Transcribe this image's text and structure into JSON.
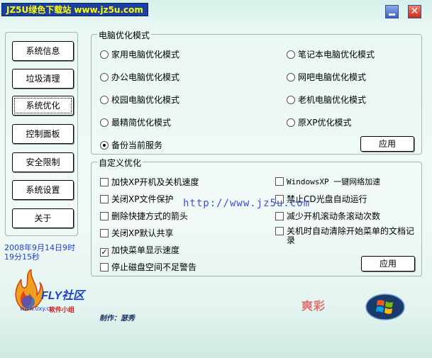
{
  "titlebar": {
    "brand": "JZ5U绿色下载站 www.jz5u.com",
    "close_glyph": "✕"
  },
  "sidebar": {
    "items": [
      {
        "label": "系统信息"
      },
      {
        "label": "垃圾清理"
      },
      {
        "label": "系统优化"
      },
      {
        "label": "控制面板"
      },
      {
        "label": "安全限制"
      },
      {
        "label": "系统设置"
      },
      {
        "label": "关于"
      }
    ],
    "active": "系统优化"
  },
  "datetime": {
    "line1": "2008年9月14日9时",
    "line2": "19分15秒"
  },
  "logo": {
    "name": "FLY社区",
    "url": "www.0xy.cn",
    "subtitle": "软件小组"
  },
  "author": "制作：瑟秀",
  "stamp": "爽彩",
  "mode_group": {
    "legend": "电脑优化模式",
    "options": [
      {
        "label": "家用电脑优化模式",
        "selected": false
      },
      {
        "label": "笔记本电脑优化模式",
        "selected": false
      },
      {
        "label": "办公电脑优化模式",
        "selected": false
      },
      {
        "label": "网吧电脑优化模式",
        "selected": false
      },
      {
        "label": "校园电脑优化模式",
        "selected": false
      },
      {
        "label": "老机电脑优化模式",
        "selected": false
      },
      {
        "label": "最精简优化模式",
        "selected": false
      },
      {
        "label": "原XP优化模式",
        "selected": false
      },
      {
        "label": "备份当前服务",
        "selected": true
      }
    ],
    "apply_label": "应用"
  },
  "custom_group": {
    "legend": "自定义优化",
    "options": [
      {
        "label": "加快XP开机及关机速度",
        "checked": false
      },
      {
        "label": "WindowsXP 一键网络加速",
        "checked": false
      },
      {
        "label": "关闭XP文件保护",
        "checked": false
      },
      {
        "label": "禁止CD光盘自动运行",
        "checked": false
      },
      {
        "label": "删除快捷方式的箭头",
        "checked": false
      },
      {
        "label": "减少开机滚动条滚动次数",
        "checked": false
      },
      {
        "label": "关闭XP默认共享",
        "checked": false
      },
      {
        "label": "关机时自动清除开始菜单的文档记",
        "label2": "录",
        "checked": false
      },
      {
        "label": "加快菜单显示速度",
        "checked": true
      },
      {
        "label": "停止磁盘空间不足警告",
        "checked": false
      }
    ],
    "apply_label": "应用"
  },
  "watermark": "http://www.jz5u.com",
  "colors": {
    "accent": "#1c3fa3",
    "background": "#eaf7f4",
    "link": "#3a4fd6"
  },
  "icons": {
    "minimize": "minimize-icon",
    "close": "close-icon",
    "check": "✓"
  }
}
